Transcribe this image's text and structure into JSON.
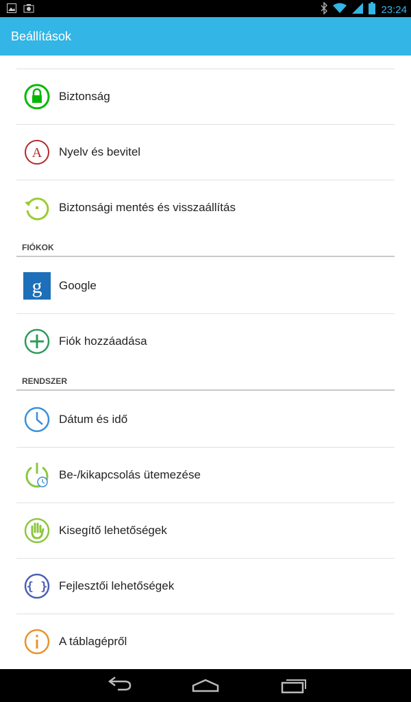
{
  "status_bar": {
    "time": "23:24",
    "icons": [
      "image-icon",
      "camera-icon",
      "bluetooth-icon",
      "wifi-icon",
      "signal-icon",
      "battery-icon"
    ]
  },
  "action_bar": {
    "title": "Beállítások"
  },
  "items": [
    {
      "label": "Biztonság",
      "icon": "lock-icon",
      "color": "#00b800"
    },
    {
      "label": "Nyelv és bevitel",
      "icon": "language-icon",
      "color": "#b02a2a"
    },
    {
      "label": "Biztonsági mentés és visszaállítás",
      "icon": "backup-restore-icon",
      "color": "#9acd32"
    }
  ],
  "sections": [
    {
      "header": "FIÓKOK",
      "items": [
        {
          "label": "Google",
          "icon": "google-icon",
          "color": "#1c6fb8"
        },
        {
          "label": "Fiók hozzáadása",
          "icon": "add-account-icon",
          "color": "#2e9a5a"
        }
      ]
    },
    {
      "header": "RENDSZER",
      "items": [
        {
          "label": "Dátum és idő",
          "icon": "clock-icon",
          "color": "#3a8fd8"
        },
        {
          "label": "Be-/kikapcsolás ütemezése",
          "icon": "power-schedule-icon",
          "color": "#8cc63f"
        },
        {
          "label": "Kisegítő lehetőségek",
          "icon": "accessibility-hand-icon",
          "color": "#8cc63f"
        },
        {
          "label": "Fejlesztői lehetőségek",
          "icon": "developer-braces-icon",
          "color": "#4a5fb5"
        },
        {
          "label": "A táblagépről",
          "icon": "info-icon",
          "color": "#e8922a"
        }
      ]
    }
  ],
  "nav_bar": {
    "buttons": [
      "back-icon",
      "home-icon",
      "recent-apps-icon"
    ]
  }
}
